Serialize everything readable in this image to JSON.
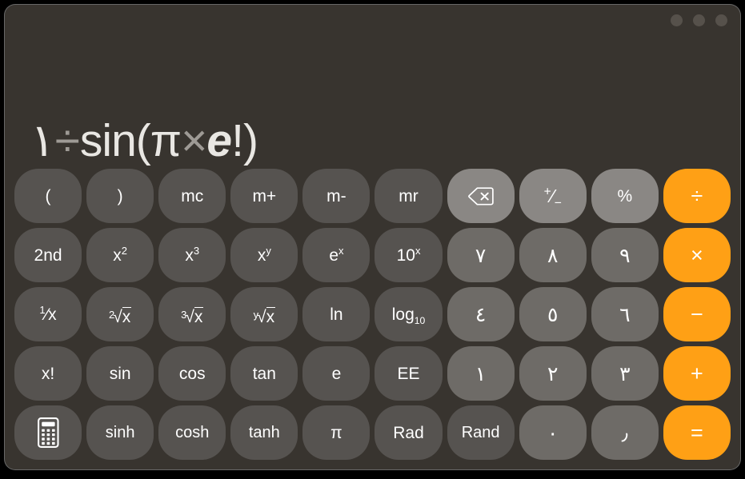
{
  "window": {
    "title": "Calculator",
    "traffic_lights": [
      "close-button",
      "minimize-button",
      "zoom-button"
    ],
    "colors": {
      "window_background": "#38342f",
      "function_key": "#565350",
      "digit_key": "#6e6b67",
      "utility_key": "#8a8784",
      "operator_key": "#ffa015",
      "key_text": "#ffffff",
      "display_text": "#e9e7e3",
      "display_operator_text": "#9e9a95"
    }
  },
  "display": {
    "expression": "١÷sin(π×e!)",
    "parts": [
      {
        "text": "١",
        "style": "normal"
      },
      {
        "text": "÷",
        "style": "operator"
      },
      {
        "text": "sin(",
        "style": "normal"
      },
      {
        "text": "π",
        "style": "normal"
      },
      {
        "text": "×",
        "style": "operator"
      },
      {
        "text": "e",
        "style": "italic"
      },
      {
        "text": "!",
        "style": "normal"
      },
      {
        "text": ")",
        "style": "normal"
      }
    ]
  },
  "keypad": {
    "rows": [
      {
        "name": "row-1",
        "keys": [
          {
            "name": "open-paren",
            "label": "(",
            "kind": "func"
          },
          {
            "name": "close-paren",
            "label": ")",
            "kind": "func"
          },
          {
            "name": "memory-clear",
            "label": "mc",
            "kind": "func"
          },
          {
            "name": "memory-add",
            "label": "m+",
            "kind": "func"
          },
          {
            "name": "memory-subtract",
            "label": "m-",
            "kind": "func"
          },
          {
            "name": "memory-recall",
            "label": "mr",
            "kind": "func"
          },
          {
            "name": "delete",
            "label": "",
            "kind": "util",
            "icon": "backspace-icon"
          },
          {
            "name": "sign-toggle",
            "label": "+/−",
            "kind": "util"
          },
          {
            "name": "percent",
            "label": "%",
            "kind": "util"
          },
          {
            "name": "divide",
            "label": "÷",
            "kind": "op"
          }
        ]
      },
      {
        "name": "row-2",
        "keys": [
          {
            "name": "second-function",
            "label": "2nd",
            "kind": "func"
          },
          {
            "name": "x-squared",
            "label": "x²",
            "kind": "func"
          },
          {
            "name": "x-cubed",
            "label": "x³",
            "kind": "func"
          },
          {
            "name": "x-to-the-y",
            "label": "xʸ",
            "kind": "func"
          },
          {
            "name": "e-to-the-x",
            "label": "eˣ",
            "kind": "func"
          },
          {
            "name": "ten-to-the-x",
            "label": "10ˣ",
            "kind": "func"
          },
          {
            "name": "digit-seven",
            "label": "٧",
            "kind": "digit"
          },
          {
            "name": "digit-eight",
            "label": "٨",
            "kind": "digit"
          },
          {
            "name": "digit-nine",
            "label": "٩",
            "kind": "digit"
          },
          {
            "name": "multiply",
            "label": "×",
            "kind": "op"
          }
        ]
      },
      {
        "name": "row-3",
        "keys": [
          {
            "name": "reciprocal",
            "label": "¹⁄x",
            "kind": "func"
          },
          {
            "name": "square-root",
            "label": "²√x",
            "kind": "func"
          },
          {
            "name": "cube-root",
            "label": "³√x",
            "kind": "func"
          },
          {
            "name": "y-root",
            "label": "ʸ√x",
            "kind": "func"
          },
          {
            "name": "natural-log",
            "label": "ln",
            "kind": "func"
          },
          {
            "name": "log-base-ten",
            "label": "log₁₀",
            "kind": "func"
          },
          {
            "name": "digit-four",
            "label": "٤",
            "kind": "digit"
          },
          {
            "name": "digit-five",
            "label": "٥",
            "kind": "digit"
          },
          {
            "name": "digit-six",
            "label": "٦",
            "kind": "digit"
          },
          {
            "name": "subtract",
            "label": "−",
            "kind": "op"
          }
        ]
      },
      {
        "name": "row-4",
        "keys": [
          {
            "name": "factorial",
            "label": "x!",
            "kind": "func"
          },
          {
            "name": "sine",
            "label": "sin",
            "kind": "func"
          },
          {
            "name": "cosine",
            "label": "cos",
            "kind": "func"
          },
          {
            "name": "tangent",
            "label": "tan",
            "kind": "func"
          },
          {
            "name": "eulers-number",
            "label": "e",
            "kind": "func"
          },
          {
            "name": "exponent-entry",
            "label": "EE",
            "kind": "func"
          },
          {
            "name": "digit-one",
            "label": "١",
            "kind": "digit"
          },
          {
            "name": "digit-two",
            "label": "٢",
            "kind": "digit"
          },
          {
            "name": "digit-three",
            "label": "٣",
            "kind": "digit"
          },
          {
            "name": "add",
            "label": "+",
            "kind": "op"
          }
        ]
      },
      {
        "name": "row-5",
        "keys": [
          {
            "name": "calculator-mode",
            "label": "",
            "kind": "func",
            "icon": "calculator-icon"
          },
          {
            "name": "hyperbolic-sine",
            "label": "sinh",
            "kind": "func"
          },
          {
            "name": "hyperbolic-cosine",
            "label": "cosh",
            "kind": "func"
          },
          {
            "name": "hyperbolic-tangent",
            "label": "tanh",
            "kind": "func"
          },
          {
            "name": "pi",
            "label": "π",
            "kind": "func"
          },
          {
            "name": "radians-toggle",
            "label": "Rad",
            "kind": "func"
          },
          {
            "name": "random",
            "label": "Rand",
            "kind": "func"
          },
          {
            "name": "digit-zero",
            "label": "٠",
            "kind": "digit"
          },
          {
            "name": "decimal-point",
            "label": "٫",
            "kind": "digit"
          },
          {
            "name": "equals",
            "label": "=",
            "kind": "op"
          }
        ]
      }
    ]
  }
}
